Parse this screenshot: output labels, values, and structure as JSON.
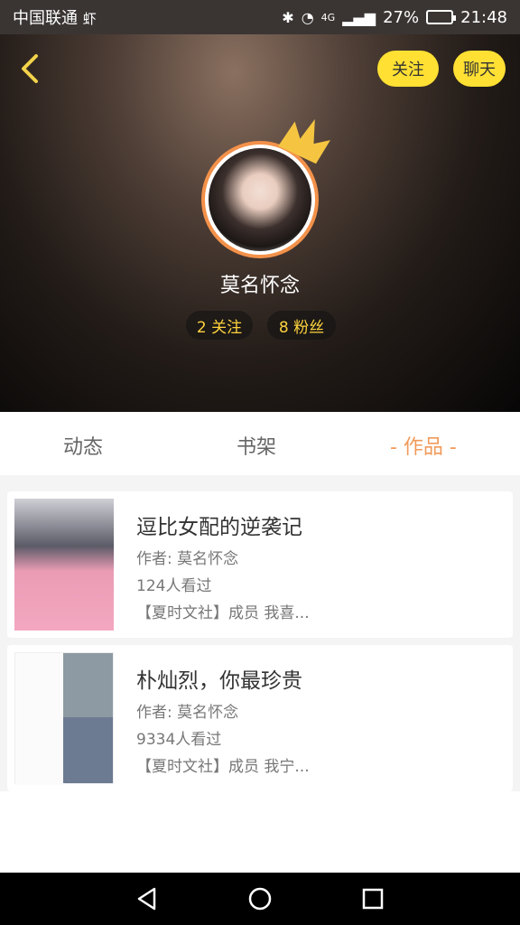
{
  "status_bar": {
    "carrier": "中国联通",
    "carrier_extra": "虾",
    "signal": "4G",
    "battery": "27%",
    "battery_level": 0.27,
    "time": "21:48"
  },
  "header": {
    "follow_button": "关注",
    "chat_button": "聊天",
    "username": "莫名怀念",
    "following": "2 关注",
    "fans": "8 粉丝"
  },
  "tabs": {
    "dynamic": "动态",
    "shelf": "书架",
    "works": "- 作品 -"
  },
  "works": [
    {
      "title": "逗比女配的逆袭记",
      "author": "作者: 莫名怀念",
      "views": "124人看过",
      "desc": "【夏时文社】成员 我喜..."
    },
    {
      "title": "朴灿烈，你最珍贵",
      "author": "作者: 莫名怀念",
      "views": "9334人看过",
      "desc": "【夏时文社】成员 我宁..."
    }
  ],
  "icons": {
    "back": "chevron-left-icon",
    "crown": "crown-icon",
    "nav_back": "triangle-back-icon",
    "nav_home": "circle-home-icon",
    "nav_recent": "square-recent-icon"
  }
}
